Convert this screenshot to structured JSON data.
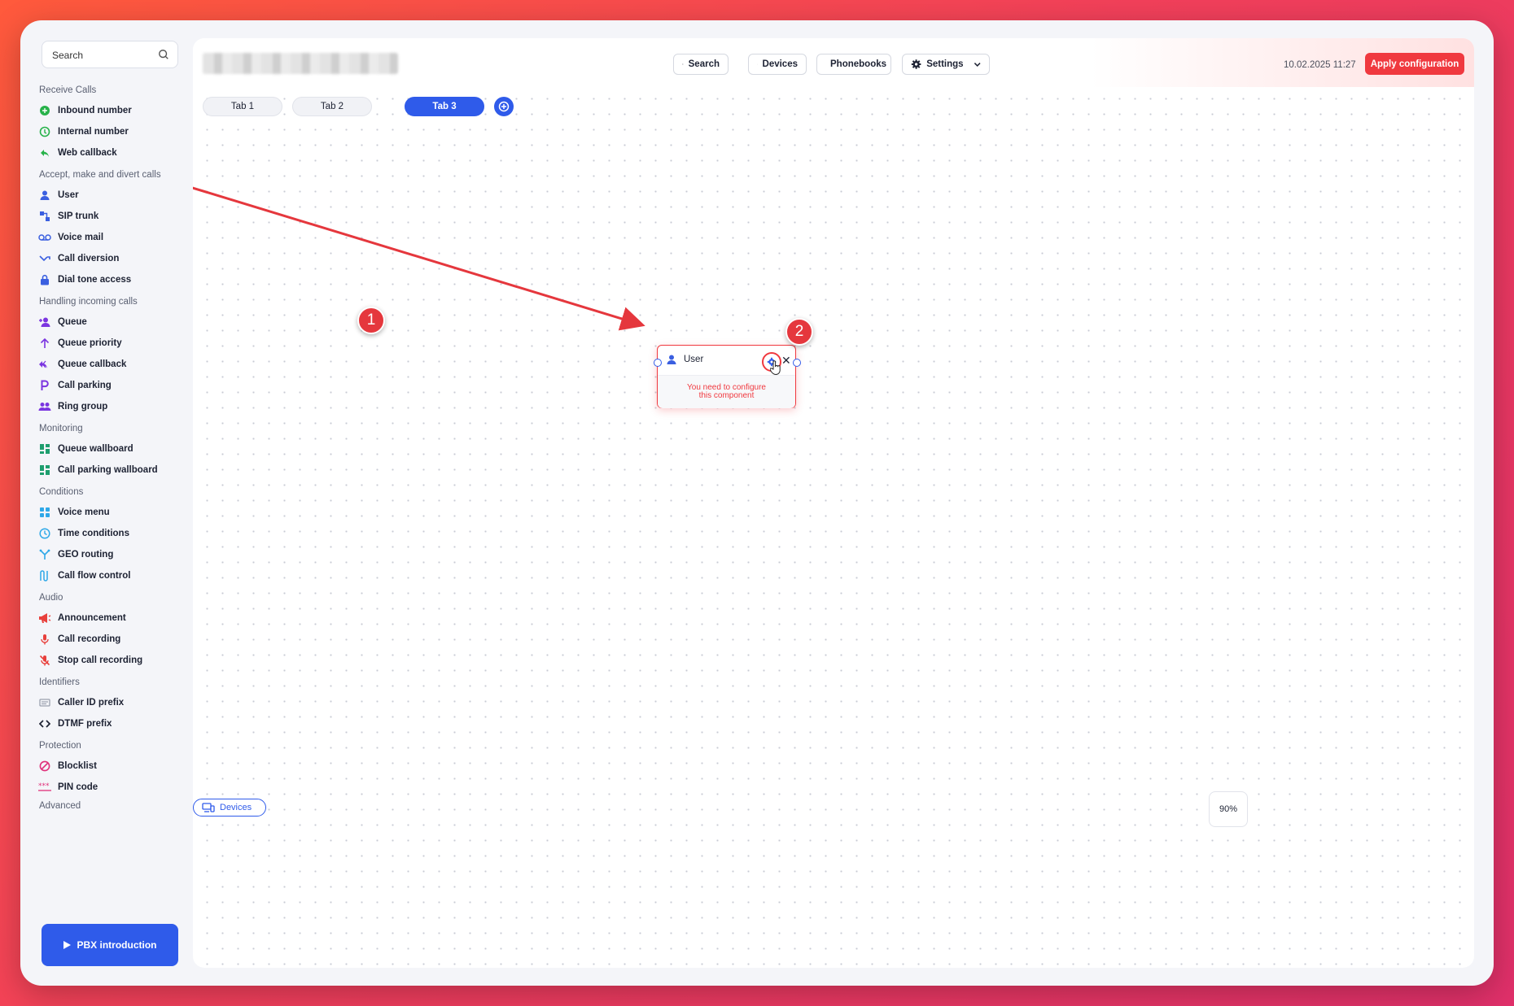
{
  "sidebar": {
    "search_placeholder": "Search",
    "sections": [
      {
        "title": "Receive Calls",
        "items": [
          {
            "label": "Inbound number",
            "icon": "inbound-number-icon"
          },
          {
            "label": "Internal number",
            "icon": "internal-number-icon"
          },
          {
            "label": "Web callback",
            "icon": "web-callback-icon"
          }
        ]
      },
      {
        "title": "Accept, make and divert calls",
        "items": [
          {
            "label": "User",
            "icon": "user-icon"
          },
          {
            "label": "SIP trunk",
            "icon": "sip-trunk-icon"
          },
          {
            "label": "Voice mail",
            "icon": "voice-mail-icon"
          },
          {
            "label": "Call diversion",
            "icon": "call-diversion-icon"
          },
          {
            "label": "Dial tone access",
            "icon": "lock-icon"
          }
        ]
      },
      {
        "title": "Handling incoming calls",
        "items": [
          {
            "label": "Queue",
            "icon": "queue-icon"
          },
          {
            "label": "Queue priority",
            "icon": "arrow-up-icon"
          },
          {
            "label": "Queue callback",
            "icon": "queue-callback-icon"
          },
          {
            "label": "Call parking",
            "icon": "parking-icon"
          },
          {
            "label": "Ring group",
            "icon": "ring-group-icon"
          }
        ]
      },
      {
        "title": "Monitoring",
        "items": [
          {
            "label": "Queue wallboard",
            "icon": "wallboard-icon"
          },
          {
            "label": "Call parking wallboard",
            "icon": "wallboard-icon"
          }
        ]
      },
      {
        "title": "Conditions",
        "items": [
          {
            "label": "Voice menu",
            "icon": "voice-menu-icon"
          },
          {
            "label": "Time conditions",
            "icon": "clock-icon"
          },
          {
            "label": "GEO routing",
            "icon": "geo-routing-icon"
          },
          {
            "label": "Call flow control",
            "icon": "call-flow-icon"
          }
        ]
      },
      {
        "title": "Audio",
        "items": [
          {
            "label": "Announcement",
            "icon": "megaphone-icon"
          },
          {
            "label": "Call recording",
            "icon": "microphone-icon"
          },
          {
            "label": "Stop call recording",
            "icon": "microphone-off-icon"
          }
        ]
      },
      {
        "title": "Identifiers",
        "items": [
          {
            "label": "Caller ID prefix",
            "icon": "caller-id-icon"
          },
          {
            "label": "DTMF prefix",
            "icon": "code-icon"
          }
        ]
      },
      {
        "title": "Protection",
        "items": [
          {
            "label": "Blocklist",
            "icon": "block-icon"
          },
          {
            "label": "PIN code",
            "icon": "pin-code-icon"
          }
        ]
      },
      {
        "title": "Advanced",
        "items": []
      }
    ],
    "intro_button": "PBX introduction"
  },
  "toolbar": {
    "search_label": "Search",
    "devices_label": "Devices",
    "phonebooks_label": "Phonebooks",
    "settings_label": "Settings",
    "timestamp": "10.02.2025 11:27",
    "apply_label": "Apply configuration"
  },
  "tabs": [
    {
      "label": "Tab 1",
      "active": false
    },
    {
      "label": "Tab 2",
      "active": false
    },
    {
      "label": "Tab 3",
      "active": true
    }
  ],
  "node": {
    "title": "User",
    "warning": "You need to configure this component",
    "close": "✕"
  },
  "annotations": [
    "1",
    "2"
  ],
  "canvas": {
    "devices_label": "Devices",
    "zoom": "90%"
  },
  "colors": {
    "accent": "#2f5bea",
    "danger": "#f0393f"
  }
}
